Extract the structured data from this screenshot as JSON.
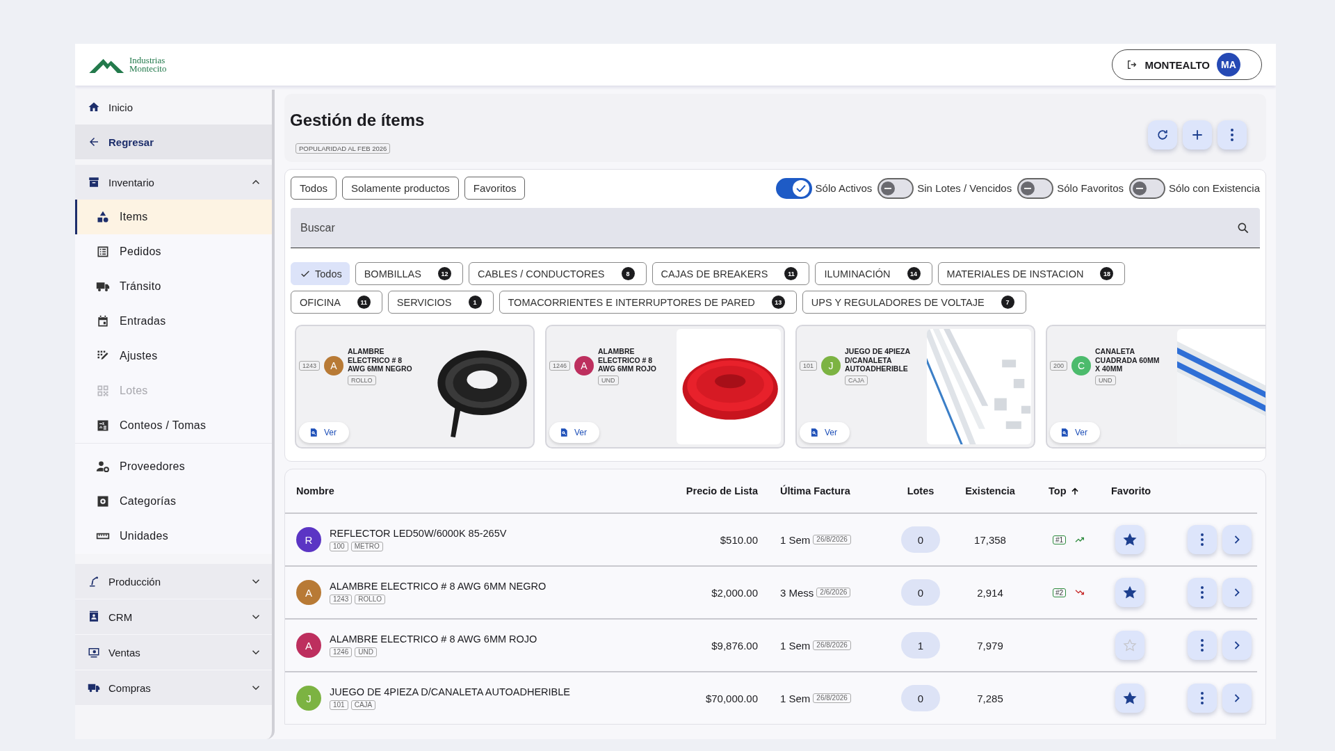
{
  "header": {
    "logo": {
      "line_1": "Industrias",
      "line_2": "Montecito"
    },
    "user": {
      "name": "MONTEALTO",
      "initials": "MA"
    }
  },
  "sidebar": {
    "items": [
      {
        "label": "Inicio",
        "kind": "link"
      },
      {
        "label": "Regresar",
        "kind": "back"
      },
      {
        "label": "Inventario",
        "kind": "group",
        "expanded": true,
        "sections": [
          {
            "children": [
              {
                "label": "Items",
                "selected": true,
                "disabled": false
              },
              {
                "label": "Pedidos",
                "selected": false,
                "disabled": false
              },
              {
                "label": "Tránsito",
                "selected": false,
                "disabled": false
              },
              {
                "label": "Entradas",
                "selected": false,
                "disabled": false
              },
              {
                "label": "Ajustes",
                "selected": false,
                "disabled": false
              },
              {
                "label": "Lotes",
                "selected": false,
                "disabled": true
              },
              {
                "label": "Conteos / Tomas",
                "selected": false,
                "disabled": false
              }
            ]
          },
          {
            "children": [
              {
                "label": "Proveedores",
                "selected": false,
                "disabled": false
              },
              {
                "label": "Categorías",
                "selected": false,
                "disabled": false
              },
              {
                "label": "Unidades",
                "selected": false,
                "disabled": false
              }
            ]
          }
        ]
      },
      {
        "label": "Producción",
        "kind": "group",
        "expanded": false
      },
      {
        "label": "CRM",
        "kind": "group",
        "expanded": false
      },
      {
        "label": "Ventas",
        "kind": "group",
        "expanded": false
      },
      {
        "label": "Compras",
        "kind": "group",
        "expanded": false
      }
    ]
  },
  "page": {
    "title": "Gestión de ítems",
    "badge": "POPULARIDAD AL FEB 2026"
  },
  "filters": {
    "scope_chips": [
      "Todos",
      "Solamente productos",
      "Favoritos"
    ],
    "toggles": [
      {
        "label": "Sólo Activos",
        "on": true
      },
      {
        "label": "Sin Lotes / Vencidos",
        "on": false
      },
      {
        "label": "Sólo Favoritos",
        "on": false
      },
      {
        "label": "Sólo con Existencia",
        "on": false
      }
    ],
    "search": {
      "placeholder": "Buscar"
    },
    "categories": [
      {
        "label": "Todos",
        "selected": true
      },
      {
        "label": "BOMBILLAS",
        "count": "12",
        "selected": false
      },
      {
        "label": "CABLES / CONDUCTORES",
        "count": "8",
        "selected": false
      },
      {
        "label": "CAJAS DE BREAKERS",
        "count": "11",
        "selected": false
      },
      {
        "label": "ILUMINACIÓN",
        "count": "14",
        "selected": false
      },
      {
        "label": "MATERIALES DE INSTACION",
        "count": "18",
        "selected": false
      },
      {
        "label": "OFICINA",
        "count": "11",
        "selected": false
      },
      {
        "label": "SERVICIOS",
        "count": "1",
        "selected": false
      },
      {
        "label": "TOMACORRIENTES E INTERRUPTORES DE PARED",
        "count": "13",
        "selected": false
      },
      {
        "label": "UPS Y REGULADORES DE VOLTAJE",
        "count": "7",
        "selected": false
      }
    ]
  },
  "cards": [
    {
      "code": "1243",
      "letter": "A",
      "color": "#b87a35",
      "name": "ALAMBRE ELECTRICO # 8 AWG 6MM NEGRO",
      "unit": "ROLLO",
      "action": "Ver"
    },
    {
      "code": "1246",
      "letter": "A",
      "color": "#bd2f5e",
      "name": "ALAMBRE ELECTRICO # 8 AWG 6MM ROJO",
      "unit": "UND",
      "action": "Ver"
    },
    {
      "code": "101",
      "letter": "J",
      "color": "#7cb342",
      "name": "JUEGO DE 4PIEZA D/CANALETA AUTOADHERIBLE",
      "unit": "CAJA",
      "action": "Ver"
    },
    {
      "code": "200",
      "letter": "C",
      "color": "#4cbb6c",
      "name": "CANALETA CUADRADA 60MM X 40MM",
      "unit": "UND",
      "action": "Ver"
    }
  ],
  "table": {
    "columns": [
      {
        "label": "Nombre"
      },
      {
        "label": "Precio de Lista"
      },
      {
        "label": "Última Factura"
      },
      {
        "label": "Lotes"
      },
      {
        "label": "Existencia"
      },
      {
        "label": "Top",
        "sorted_ascending": true
      },
      {
        "label": "Favorito"
      }
    ],
    "rows": [
      {
        "letter": "R",
        "color": "#5b35c4",
        "name": "REFLECTOR LED50W/6000K 85-265V",
        "code": "100",
        "unit": "METRO",
        "price": "$510.00",
        "last_invoice": "1 Sem",
        "invoice_date": "26/8/2026",
        "lots": "0",
        "stock": "17,358",
        "rank": "#1",
        "trend_up": true,
        "favorite": true
      },
      {
        "letter": "A",
        "color": "#b87a35",
        "name": "ALAMBRE ELECTRICO # 8 AWG 6MM NEGRO",
        "code": "1243",
        "unit": "ROLLO",
        "price": "$2,000.00",
        "last_invoice": "3 Mess",
        "invoice_date": "2/6/2026",
        "lots": "0",
        "stock": "2,914",
        "rank": "#2",
        "trend_up": false,
        "favorite": true
      },
      {
        "letter": "A",
        "color": "#bd2f5e",
        "name": "ALAMBRE ELECTRICO # 8 AWG 6MM ROJO",
        "code": "1246",
        "unit": "UND",
        "price": "$9,876.00",
        "last_invoice": "1 Sem",
        "invoice_date": "26/8/2026",
        "lots": "1",
        "stock": "7,979",
        "favorite": false
      },
      {
        "letter": "J",
        "color": "#7cb342",
        "name": "JUEGO DE 4PIEZA D/CANALETA AUTOADHERIBLE",
        "code": "101",
        "unit": "CAJA",
        "price": "$70,000.00",
        "last_invoice": "1 Sem",
        "invoice_date": "26/8/2026",
        "lots": "0",
        "stock": "7,285",
        "favorite": true
      }
    ]
  }
}
